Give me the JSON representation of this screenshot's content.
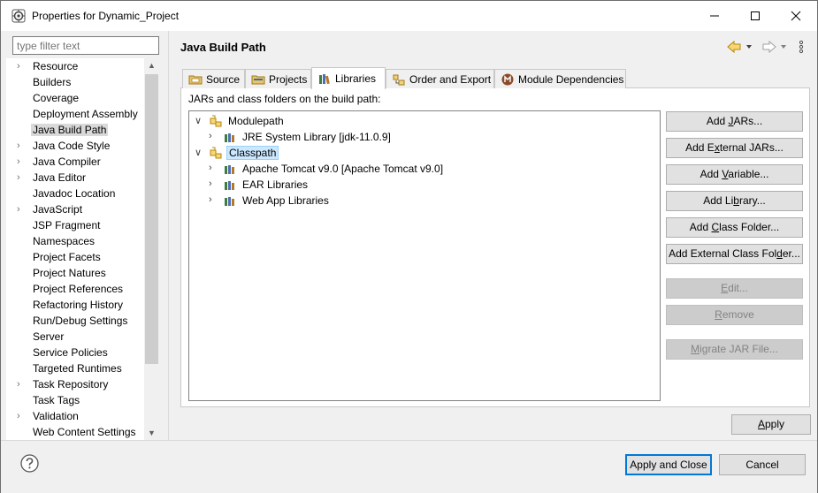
{
  "window": {
    "title": "Properties for Dynamic_Project"
  },
  "filter": {
    "placeholder": "type filter text"
  },
  "nav": {
    "items": [
      {
        "label": "Resource",
        "expandable": true
      },
      {
        "label": "Builders",
        "expandable": false
      },
      {
        "label": "Coverage",
        "expandable": false
      },
      {
        "label": "Deployment Assembly",
        "expandable": false
      },
      {
        "label": "Java Build Path",
        "expandable": false,
        "selected": true
      },
      {
        "label": "Java Code Style",
        "expandable": true
      },
      {
        "label": "Java Compiler",
        "expandable": true
      },
      {
        "label": "Java Editor",
        "expandable": true
      },
      {
        "label": "Javadoc Location",
        "expandable": false
      },
      {
        "label": "JavaScript",
        "expandable": true
      },
      {
        "label": "JSP Fragment",
        "expandable": false
      },
      {
        "label": "Namespaces",
        "expandable": false
      },
      {
        "label": "Project Facets",
        "expandable": false
      },
      {
        "label": "Project Natures",
        "expandable": false
      },
      {
        "label": "Project References",
        "expandable": false
      },
      {
        "label": "Refactoring History",
        "expandable": false
      },
      {
        "label": "Run/Debug Settings",
        "expandable": false
      },
      {
        "label": "Server",
        "expandable": false
      },
      {
        "label": "Service Policies",
        "expandable": false
      },
      {
        "label": "Targeted Runtimes",
        "expandable": false
      },
      {
        "label": "Task Repository",
        "expandable": true
      },
      {
        "label": "Task Tags",
        "expandable": false
      },
      {
        "label": "Validation",
        "expandable": true
      },
      {
        "label": "Web Content Settings",
        "expandable": false
      }
    ]
  },
  "page": {
    "title": "Java Build Path"
  },
  "tabs": [
    {
      "label": "Source"
    },
    {
      "label": "Projects"
    },
    {
      "label": "Libraries",
      "active": true
    },
    {
      "label": "Order and Export"
    },
    {
      "label": "Module Dependencies"
    }
  ],
  "libraries": {
    "caption": "JARs and class folders on the build path:",
    "tree": [
      {
        "label": "Modulepath",
        "expanded": true
      },
      {
        "label": "JRE System Library [jdk-11.0.9]",
        "expanded": false
      },
      {
        "label": "Classpath",
        "expanded": true,
        "selected": true
      },
      {
        "label": "Apache Tomcat v9.0 [Apache Tomcat v9.0]",
        "expanded": false
      },
      {
        "label": "EAR Libraries",
        "expanded": false
      },
      {
        "label": "Web App Libraries",
        "expanded": false
      }
    ],
    "buttons": [
      {
        "pre": "Add ",
        "key": "J",
        "post": "ARs...",
        "enabled": true
      },
      {
        "pre": "Add E",
        "key": "x",
        "post": "ternal JARs...",
        "enabled": true
      },
      {
        "pre": "Add ",
        "key": "V",
        "post": "ariable...",
        "enabled": true
      },
      {
        "pre": "Add Li",
        "key": "b",
        "post": "rary...",
        "enabled": true
      },
      {
        "pre": "Add ",
        "key": "C",
        "post": "lass Folder...",
        "enabled": true
      },
      {
        "pre": "Add External Class Fol",
        "key": "d",
        "post": "er...",
        "enabled": true
      },
      {
        "pre": "",
        "key": "E",
        "post": "dit...",
        "enabled": false
      },
      {
        "pre": "",
        "key": "R",
        "post": "emove",
        "enabled": false
      },
      {
        "pre": "",
        "key": "M",
        "post": "igrate JAR File...",
        "enabled": false
      }
    ]
  },
  "footer": {
    "apply": {
      "pre": "",
      "key": "A",
      "post": "pply"
    },
    "apply_close": "Apply and Close",
    "cancel": "Cancel"
  },
  "colors": {
    "selection": "#cce8ff",
    "default_button_border": "#0078d7",
    "nav_selected": "#d9d9d9"
  }
}
